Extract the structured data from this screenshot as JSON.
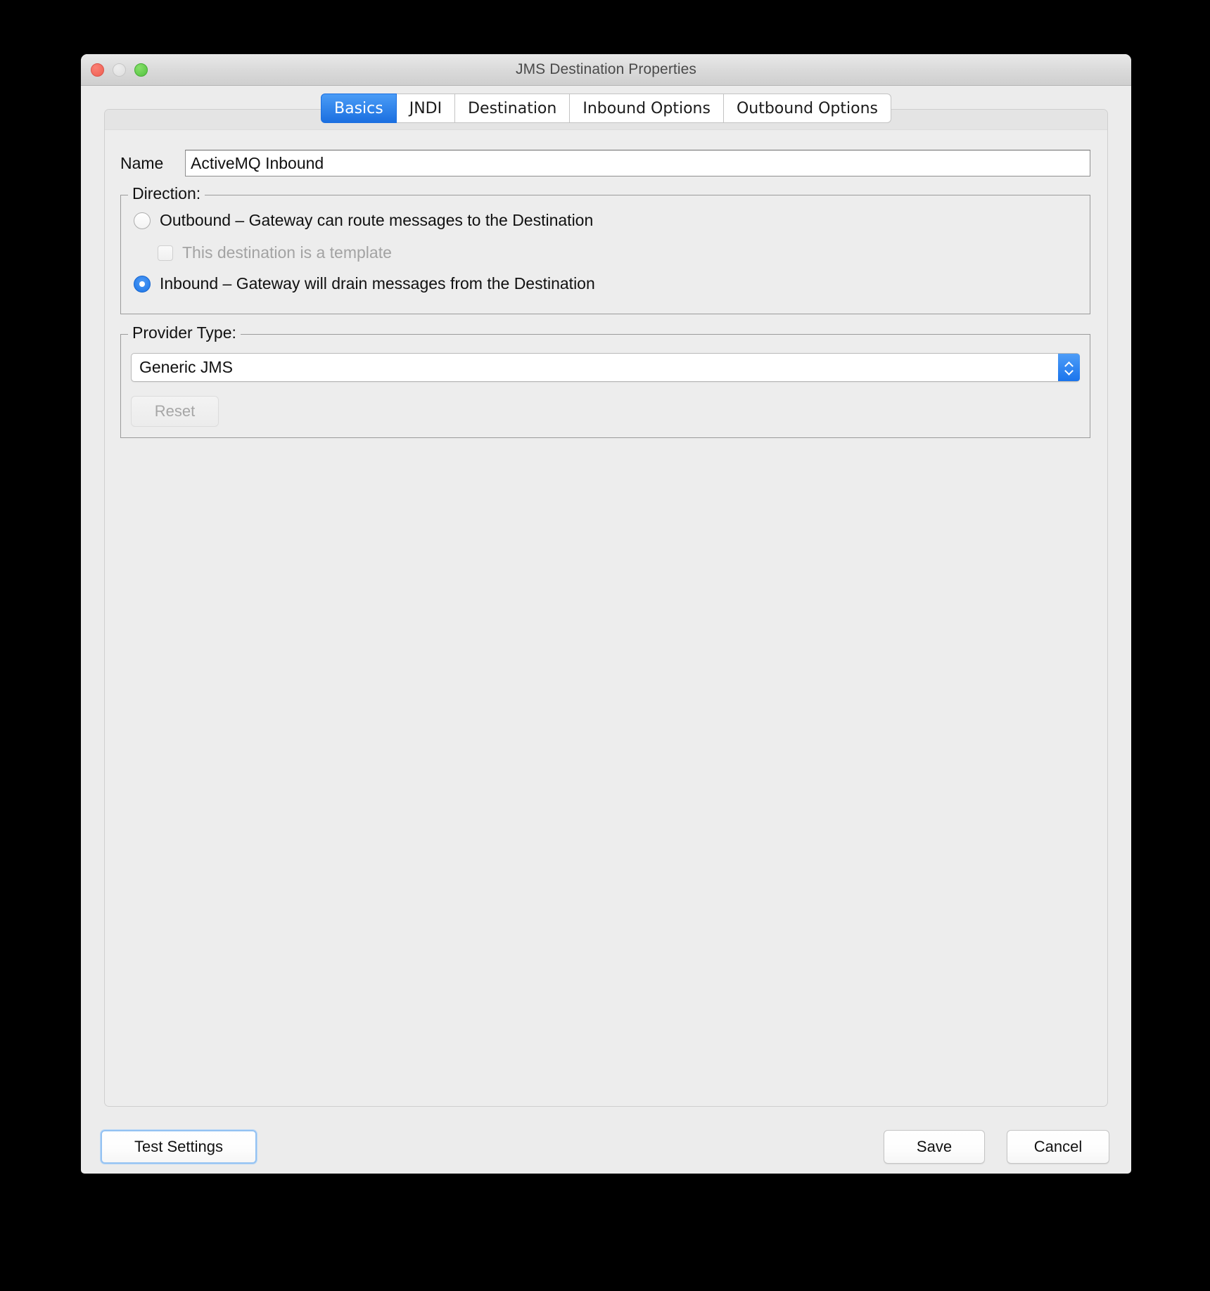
{
  "window": {
    "title": "JMS Destination Properties",
    "traffic_lights": [
      {
        "name": "close",
        "color": "#ef5e50"
      },
      {
        "name": "minimize",
        "color": "#dedede"
      },
      {
        "name": "zoom",
        "color": "#53c13f"
      }
    ]
  },
  "tabs": [
    {
      "id": "basics",
      "label": "Basics",
      "active": true
    },
    {
      "id": "jndi",
      "label": "JNDI",
      "active": false
    },
    {
      "id": "destination",
      "label": "Destination",
      "active": false
    },
    {
      "id": "inbound-options",
      "label": "Inbound Options",
      "active": false
    },
    {
      "id": "outbound-options",
      "label": "Outbound Options",
      "active": false
    }
  ],
  "form": {
    "name": {
      "label": "Name",
      "value": "ActiveMQ Inbound",
      "placeholder": ""
    },
    "direction": {
      "legend": "Direction:",
      "outbound": {
        "label": "Outbound – Gateway can route messages to the Destination",
        "selected": false
      },
      "template": {
        "label": "This destination is a template",
        "checked": false,
        "disabled": true
      },
      "inbound": {
        "label": "Inbound – Gateway will drain messages from the Destination",
        "selected": true
      }
    },
    "provider_type": {
      "legend": "Provider Type:",
      "selected": "Generic JMS",
      "stepper_icon": "chevron-up-down-icon",
      "reset": {
        "label": "Reset",
        "disabled": true
      }
    }
  },
  "footer": {
    "test_settings_label": "Test Settings",
    "save_label": "Save",
    "cancel_label": "Cancel"
  },
  "colors": {
    "accent_blue": "#1a74ec",
    "tab_active_blue": "#1b6fe0",
    "window_bg": "#ececec",
    "panel_bg": "#ededed",
    "focus_ring": "#94c2f2"
  }
}
